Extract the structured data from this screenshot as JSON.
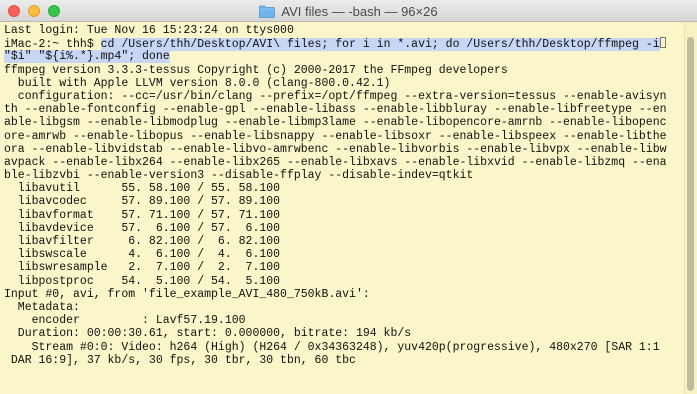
{
  "window": {
    "title": "AVI files — -bash — 96×26"
  },
  "terminal": {
    "login": "Last login: Tue Nov 16 15:23:24 on ttys000",
    "prompt": "iMac-2:~ thh$ ",
    "command_line1": "cd /Users/thh/Desktop/AVI\\ files; for i in *.avi; do /Users/thh/Desktop/ffmpeg -i",
    "command_line2": "\"$i\" \"${i%.*}.mp4\"; done",
    "output": [
      "ffmpeg version 3.3.3-tessus Copyright (c) 2000-2017 the FFmpeg developers",
      "  built with Apple LLVM version 8.0.0 (clang-800.0.42.1)",
      "  configuration: --cc=/usr/bin/clang --prefix=/opt/ffmpeg --extra-version=tessus --enable-avisyn",
      "th --enable-fontconfig --enable-gpl --enable-libass --enable-libbluray --enable-libfreetype --en",
      "able-libgsm --enable-libmodplug --enable-libmp3lame --enable-libopencore-amrnb --enable-libopenc",
      "ore-amrwb --enable-libopus --enable-libsnappy --enable-libsoxr --enable-libspeex --enable-libthe",
      "ora --enable-libvidstab --enable-libvo-amrwbenc --enable-libvorbis --enable-libvpx --enable-libw",
      "avpack --enable-libx264 --enable-libx265 --enable-libxavs --enable-libxvid --enable-libzmq --ena",
      "ble-libzvbi --enable-version3 --disable-ffplay --disable-indev=qtkit",
      "  libavutil      55. 58.100 / 55. 58.100",
      "  libavcodec     57. 89.100 / 57. 89.100",
      "  libavformat    57. 71.100 / 57. 71.100",
      "  libavdevice    57.  6.100 / 57.  6.100",
      "  libavfilter     6. 82.100 /  6. 82.100",
      "  libswscale      4.  6.100 /  4.  6.100",
      "  libswresample   2.  7.100 /  2.  7.100",
      "  libpostproc    54.  5.100 / 54.  5.100",
      "Input #0, avi, from 'file_example_AVI_480_750kB.avi':",
      "  Metadata:",
      "    encoder         : Lavf57.19.100",
      "  Duration: 00:00:30.61, start: 0.000000, bitrate: 194 kb/s",
      "    Stream #0:0: Video: h264 (High) (H264 / 0x34363248), yuv420p(progressive), 480x270 [SAR 1:1",
      " DAR 16:9], 37 kb/s, 30 fps, 30 tbr, 30 tbn, 60 tbc"
    ]
  },
  "colors": {
    "terminal_background": "#fbf6c9",
    "selection_highlight": "#c7d6f4",
    "text": "#111111"
  },
  "icons": {
    "title_icon": "folder-icon"
  }
}
